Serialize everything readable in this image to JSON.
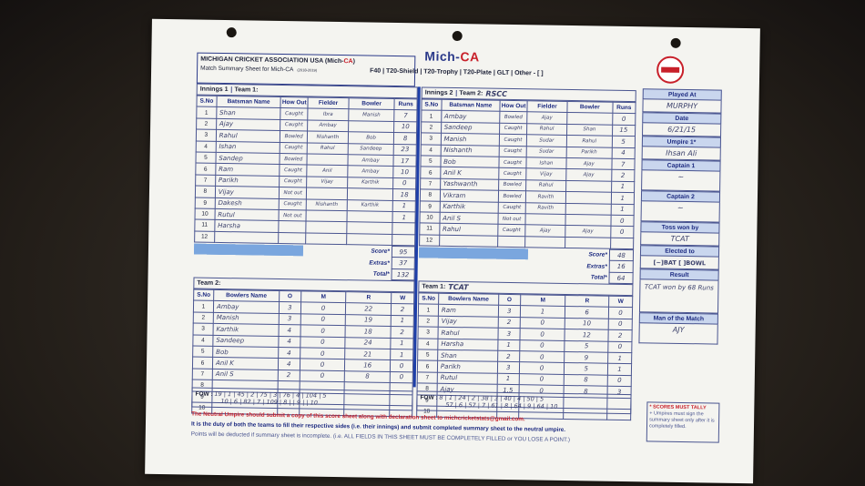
{
  "header": {
    "org_prefix": "MICHIGAN CRICKET ASSOCIATION USA (",
    "org_brand": "Mich-",
    "org_brand_red": "CA",
    "org_suffix": ")",
    "sheet_title": "Match Summary Sheet for Mich-CA",
    "sheet_code": "(2018-2019)",
    "brand_left": "Mich-",
    "brand_right": "CA",
    "formats": "F40 | T20-Shield | T20-Trophy | T20-Plate | GLT | Other - [             ]"
  },
  "innings1": {
    "label": "Innings 1",
    "team_label": "Team 1:",
    "team_value": "",
    "columns": [
      "S.No",
      "Batsman Name",
      "How Out",
      "Fielder",
      "Bowler",
      "Runs"
    ],
    "rows": [
      {
        "no": "1",
        "name": "Shan",
        "how": "Caught",
        "fielder": "Ibra",
        "bowler": "Manish",
        "runs": "7"
      },
      {
        "no": "2",
        "name": "Ajay",
        "how": "Caught",
        "fielder": "Ambay",
        "bowler": "",
        "runs": "10"
      },
      {
        "no": "3",
        "name": "Rahul",
        "how": "Bowled",
        "fielder": "Nishanth",
        "bowler": "Bob",
        "runs": "8"
      },
      {
        "no": "4",
        "name": "Ishan",
        "how": "Caught",
        "fielder": "Rahul",
        "bowler": "Sandeep",
        "runs": "23"
      },
      {
        "no": "5",
        "name": "Sandep",
        "how": "Bowled",
        "fielder": "",
        "bowler": "Ambay",
        "runs": "17"
      },
      {
        "no": "6",
        "name": "Ram",
        "how": "Caught",
        "fielder": "Anil",
        "bowler": "Ambay",
        "runs": "10"
      },
      {
        "no": "7",
        "name": "Parikh",
        "how": "Caught",
        "fielder": "Vijay",
        "bowler": "Karthik",
        "runs": "0"
      },
      {
        "no": "8",
        "name": "Vijay",
        "how": "Not out",
        "fielder": "",
        "bowler": "",
        "runs": "18"
      },
      {
        "no": "9",
        "name": "Dakesh",
        "how": "Caught",
        "fielder": "Nishanth",
        "bowler": "Karthik",
        "runs": "1"
      },
      {
        "no": "10",
        "name": "Rutul",
        "how": "Not out",
        "fielder": "",
        "bowler": "",
        "runs": "1"
      },
      {
        "no": "11",
        "name": "Harsha",
        "how": "",
        "fielder": "",
        "bowler": "",
        "runs": ""
      },
      {
        "no": "12",
        "name": "",
        "how": "",
        "fielder": "",
        "bowler": "",
        "runs": ""
      }
    ],
    "score_label": "Score*",
    "score": "95",
    "extras_label": "Extras*",
    "extras": "37",
    "total_label": "Total*",
    "total": "132"
  },
  "innings2": {
    "label": "Innings 2",
    "team_label": "Team 2:",
    "team_value": "RSCC",
    "columns": [
      "S.No",
      "Batsman Name",
      "How Out",
      "Fielder",
      "Bowler",
      "Runs"
    ],
    "rows": [
      {
        "no": "1",
        "name": "Ambay",
        "how": "Bowled",
        "fielder": "Ajay",
        "bowler": "",
        "runs": "0"
      },
      {
        "no": "2",
        "name": "Sandeep",
        "how": "Caught",
        "fielder": "Rahul",
        "bowler": "Shan",
        "runs": "15"
      },
      {
        "no": "3",
        "name": "Manish",
        "how": "Caught",
        "fielder": "Sudar",
        "bowler": "Rahul",
        "runs": "5"
      },
      {
        "no": "4",
        "name": "Nishanth",
        "how": "Caught",
        "fielder": "Sudar",
        "bowler": "Parikh",
        "runs": "4"
      },
      {
        "no": "5",
        "name": "Bob",
        "how": "Caught",
        "fielder": "Ishan",
        "bowler": "Ajay",
        "runs": "7"
      },
      {
        "no": "6",
        "name": "Anil K",
        "how": "Caught",
        "fielder": "Vijay",
        "bowler": "Ajay",
        "runs": "2"
      },
      {
        "no": "7",
        "name": "Yashwanth",
        "how": "Bowled",
        "fielder": "Rahul",
        "bowler": "",
        "runs": "1"
      },
      {
        "no": "8",
        "name": "Vikram",
        "how": "Bowled",
        "fielder": "Ravith",
        "bowler": "",
        "runs": "1"
      },
      {
        "no": "9",
        "name": "Karthik",
        "how": "Caught",
        "fielder": "Ravith",
        "bowler": "",
        "runs": "1"
      },
      {
        "no": "10",
        "name": "Anil S",
        "how": "Not out",
        "fielder": "",
        "bowler": "",
        "runs": "0"
      },
      {
        "no": "11",
        "name": "Rahul",
        "how": "Caught",
        "fielder": "Ajay",
        "bowler": "Ajay",
        "runs": "0"
      },
      {
        "no": "12",
        "name": "",
        "how": "",
        "fielder": "",
        "bowler": "",
        "runs": ""
      }
    ],
    "score_label": "Score*",
    "score": "48",
    "extras_label": "Extras*",
    "extras": "16",
    "total_label": "Total*",
    "total": "64"
  },
  "bowling_team2": {
    "label": "Team 2:",
    "columns": [
      "S.No",
      "Bowlers Name",
      "O",
      "M",
      "R",
      "W"
    ],
    "rows": [
      {
        "no": "1",
        "name": "Ambay",
        "o": "3",
        "m": "0",
        "r": "22",
        "w": "2"
      },
      {
        "no": "2",
        "name": "Manish",
        "o": "3",
        "m": "0",
        "r": "19",
        "w": "1"
      },
      {
        "no": "3",
        "name": "Karthik",
        "o": "4",
        "m": "0",
        "r": "18",
        "w": "2"
      },
      {
        "no": "4",
        "name": "Sandeep",
        "o": "4",
        "m": "0",
        "r": "24",
        "w": "1"
      },
      {
        "no": "5",
        "name": "Bob",
        "o": "4",
        "m": "0",
        "r": "21",
        "w": "1"
      },
      {
        "no": "6",
        "name": "Anil K",
        "o": "4",
        "m": "0",
        "r": "16",
        "w": "0"
      },
      {
        "no": "7",
        "name": "Anil S",
        "o": "2",
        "m": "0",
        "r": "8",
        "w": "0"
      },
      {
        "no": "8",
        "name": "",
        "o": "",
        "m": "",
        "r": "",
        "w": ""
      },
      {
        "no": "9",
        "name": "",
        "o": "",
        "m": "",
        "r": "",
        "w": ""
      },
      {
        "no": "10",
        "name": "",
        "o": "",
        "m": "",
        "r": "",
        "w": ""
      }
    ]
  },
  "bowling_team1": {
    "label": "Team 1:",
    "team_value": "TCAT",
    "columns": [
      "S.No",
      "Bowlers Name",
      "O",
      "M",
      "R",
      "W"
    ],
    "rows": [
      {
        "no": "1",
        "name": "Ram",
        "o": "3",
        "m": "1",
        "r": "6",
        "w": "0"
      },
      {
        "no": "2",
        "name": "Vijay",
        "o": "2",
        "m": "0",
        "r": "10",
        "w": "0"
      },
      {
        "no": "3",
        "name": "Rahul",
        "o": "3",
        "m": "0",
        "r": "12",
        "w": "2"
      },
      {
        "no": "4",
        "name": "Harsha",
        "o": "1",
        "m": "0",
        "r": "5",
        "w": "0"
      },
      {
        "no": "5",
        "name": "Shan",
        "o": "2",
        "m": "0",
        "r": "9",
        "w": "1"
      },
      {
        "no": "6",
        "name": "Parikh",
        "o": "3",
        "m": "0",
        "r": "5",
        "w": "1"
      },
      {
        "no": "7",
        "name": "Rutul",
        "o": "1",
        "m": "0",
        "r": "8",
        "w": "0"
      },
      {
        "no": "8",
        "name": "Ajay",
        "o": "1.5",
        "m": "0",
        "r": "8",
        "w": "3"
      },
      {
        "no": "9",
        "name": "",
        "o": "",
        "m": "",
        "r": "",
        "w": ""
      },
      {
        "no": "10",
        "name": "",
        "o": "",
        "m": "",
        "r": "",
        "w": ""
      }
    ]
  },
  "fow_left": {
    "label": "FOW :",
    "line1": "19 | 1  | 45 | 2  | 75 | 3  | 76 | 4  | 104 | 5",
    "line2": "10 | 6  | 82 | 7  | 109 | 8  |    | 9  |     | 10"
  },
  "fow_right": {
    "label": "FOW :",
    "line1": "8 | 1  | 24 | 2  | 38 | 3  | 40 | 4  | 50 | 5",
    "line2": "57 | 6  | 57 | 7  | 61 | 8  | 64 | 9  | 64 | 10"
  },
  "side": {
    "played_at_label": "Played At",
    "played_at": "MURPHY",
    "date_label": "Date",
    "date": "6/21/15",
    "umpire_label": "Umpire 1*",
    "umpire": "Ihsan Ali",
    "captain1_label": "Captain 1",
    "captain1": "~",
    "captain2_label": "Captain 2",
    "captain2": "~",
    "toss_label": "Toss won by",
    "toss": "TCAT",
    "elected_label": "Elected to",
    "elected": "[~]BAT  [ ]BOWL",
    "result_label": "Result",
    "result": "TCAT won by 68 Runs",
    "mom_label": "Man of the Match",
    "mom": "AJY"
  },
  "tally": {
    "heading": "* SCORES MUST TALLY",
    "text": "+ Umpires must sign the summary sheet only after it is completely filled."
  },
  "notes": {
    "line1": "The Neutral Umpire should submit a copy of this score sheet along with declaration sheet to michcricketstats@gmail.com.",
    "line2": "It is the duty of both the teams to fill their respective sides (i.e. their innings) and submit completed summary sheet to the neutral umpire.",
    "line3": "Points will be deducted if summary sheet is incomplete. (i.e. ALL FIELDS IN THIS SHEET MUST BE COMPLETELY FILLED or YOU LOSE A POINT.)"
  },
  "colors": {
    "accent": "#1e3fa8",
    "brand_red": "#c8202a",
    "bar": "#7aa6de"
  }
}
